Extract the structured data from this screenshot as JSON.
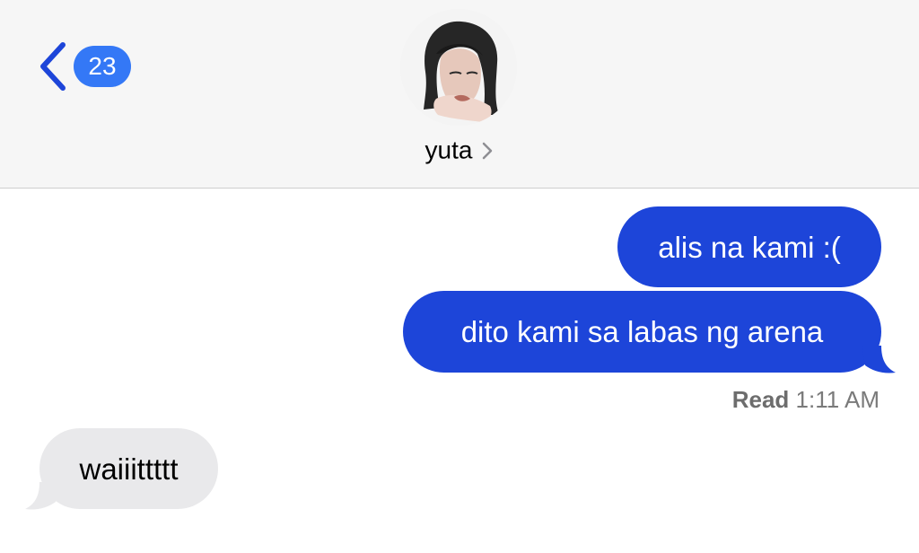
{
  "header": {
    "unread_count": "23",
    "contact_name": "yuta"
  },
  "messages": [
    {
      "direction": "sent",
      "text": "alis na kami :("
    },
    {
      "direction": "sent",
      "text": "dito kami sa labas ng arena"
    },
    {
      "direction": "received",
      "text": "waiiittttt"
    }
  ],
  "receipt": {
    "label": "Read",
    "time": "1:11 AM"
  },
  "colors": {
    "accent": "#3478f6",
    "sent_bubble": "#1d45d9",
    "received_bubble": "#e9e9eb",
    "header_bg": "#f6f6f6"
  },
  "icons": {
    "back": "chevron-left-icon",
    "contact_details": "chevron-right-icon"
  }
}
